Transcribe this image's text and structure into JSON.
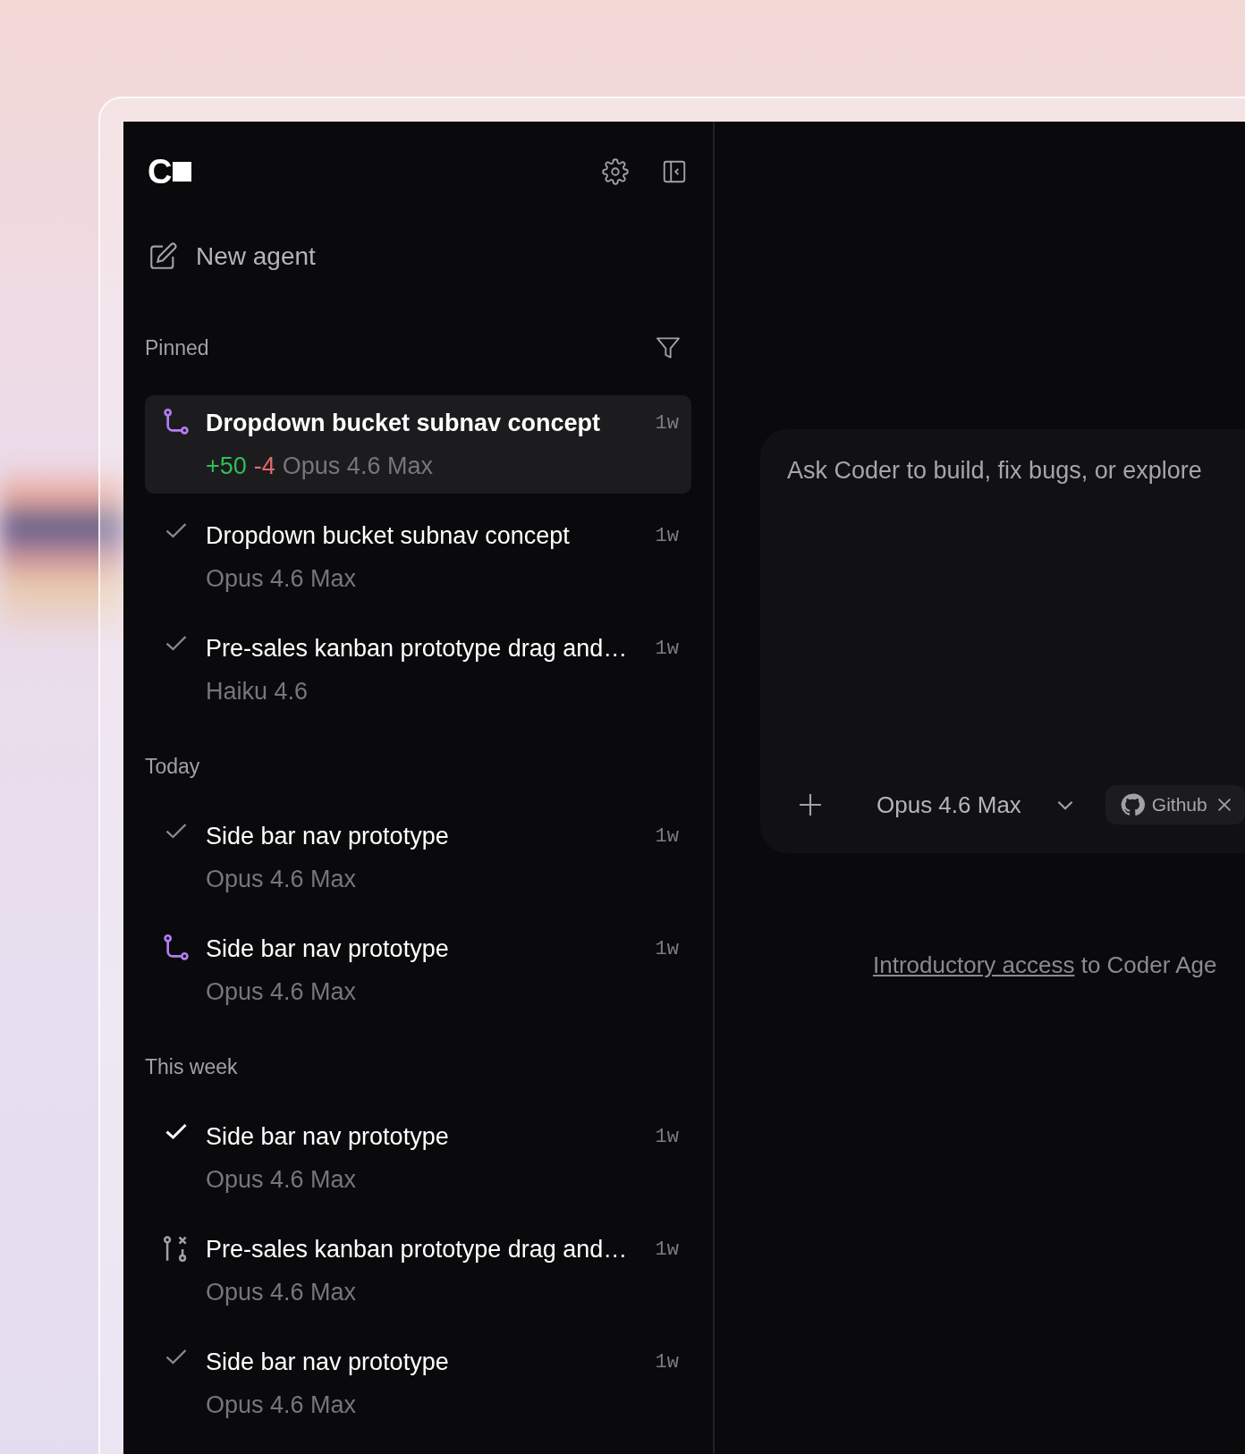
{
  "sidebar": {
    "logo": "C",
    "new_agent": "New agent",
    "sections": [
      {
        "label": "Pinned",
        "kind": "pinned",
        "items": [
          {
            "kind": "branch",
            "title": "Dropdown bucket subnav concept",
            "added": "+50",
            "removed": "-4",
            "model": "Opus 4.6 Max",
            "age": "1w",
            "selected": true
          },
          {
            "kind": "done",
            "title": "Dropdown bucket subnav concept",
            "model": "Opus 4.6 Max",
            "age": "1w",
            "selected": false
          },
          {
            "kind": "done",
            "title": "Pre-sales kanban prototype drag and…",
            "model": "Haiku 4.6",
            "age": "1w",
            "selected": false
          }
        ]
      },
      {
        "label": "Today",
        "kind": "dated",
        "items": [
          {
            "kind": "done",
            "title": "Side bar nav prototype",
            "model": "Opus 4.6 Max",
            "age": "1w",
            "selected": false
          },
          {
            "kind": "branch",
            "title": "Side bar nav prototype",
            "model": "Opus 4.6 Max",
            "age": "1w",
            "selected": false
          }
        ]
      },
      {
        "label": "This week",
        "kind": "dated",
        "items": [
          {
            "kind": "ready",
            "title": "Side bar nav prototype",
            "model": "Opus 4.6 Max",
            "age": "1w",
            "selected": false
          },
          {
            "kind": "closed",
            "title": "Pre-sales kanban prototype drag and…",
            "model": "Opus 4.6 Max",
            "age": "1w",
            "selected": false
          },
          {
            "kind": "done",
            "title": "Side bar nav prototype",
            "model": "Opus 4.6 Max",
            "age": "1w",
            "selected": false
          }
        ]
      }
    ]
  },
  "composer": {
    "placeholder": "Ask Coder to build, fix bugs, or explore",
    "model": "Opus 4.6 Max",
    "repo_chip": "Github"
  },
  "footer": {
    "link": "Introductory access",
    "text": "to Coder Age"
  }
}
